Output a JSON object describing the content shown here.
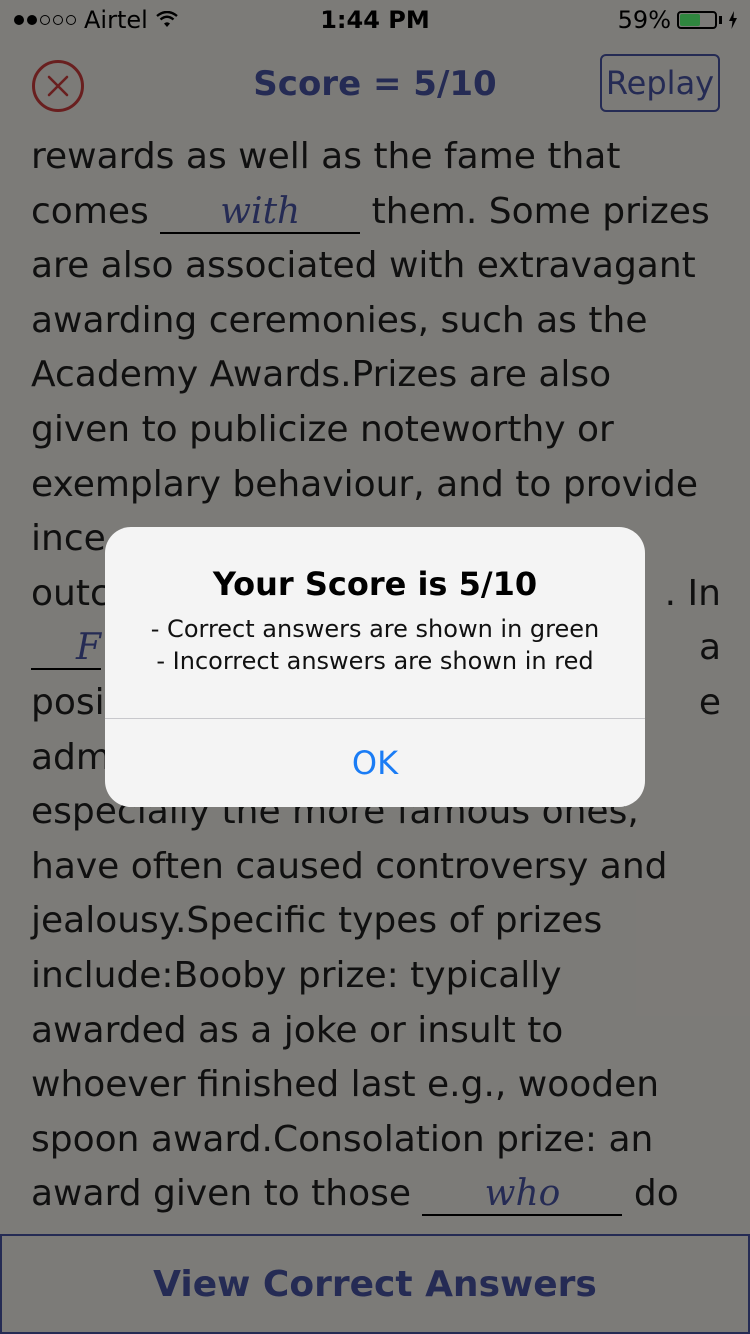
{
  "status": {
    "carrier": "Airtel",
    "time": "1:44 PM",
    "battery_pct": "59%",
    "battery_level": 0.59,
    "signal_bars_filled": 2,
    "signal_bars_total": 5
  },
  "nav": {
    "score_title": "Score = 5/10",
    "replay_label": "Replay"
  },
  "passage": {
    "lines": [
      {
        "text": "rewards as well as the fame that"
      },
      {
        "pre": "comes ",
        "blank": "with",
        "post": " them. Some prizes"
      },
      {
        "text": "are also associated with extravagant"
      },
      {
        "text": "awarding ceremonies, such as the"
      },
      {
        "text": "Academy Awards.Prizes are also"
      },
      {
        "text": "given to publicize noteworthy or"
      },
      {
        "text": "exemplary behaviour, and to provide"
      },
      {
        "text": "ince"
      },
      {
        "text": "outc",
        "tail": ". In"
      },
      {
        "blank_left": "F",
        "tail": "a"
      },
      {
        "text": "posi",
        "tail": "e"
      },
      {
        "text": "adm"
      },
      {
        "text": "especially the more famous ones,"
      },
      {
        "text": "have often caused controversy and"
      },
      {
        "text": "jealousy.Specific types of prizes"
      },
      {
        "text": "include:Booby prize: typically"
      },
      {
        "text": "awarded as a joke or insult to"
      },
      {
        "text": "whoever finished last e.g., wooden"
      },
      {
        "text": "spoon award.Consolation prize: an"
      },
      {
        "pre": "award given to those ",
        "blank": "who",
        "post": " do"
      }
    ]
  },
  "bottom_button": "View Correct Answers",
  "alert": {
    "title": "Your Score is 5/10",
    "line1": "- Correct answers are shown in green",
    "line2": "- Incorrect answers are shown in red",
    "ok_label": "OK"
  },
  "colors": {
    "accent": "#3d4688",
    "close_red": "#aa3333",
    "ios_blue": "#1a7cf5",
    "battery_green": "#4cd964"
  }
}
